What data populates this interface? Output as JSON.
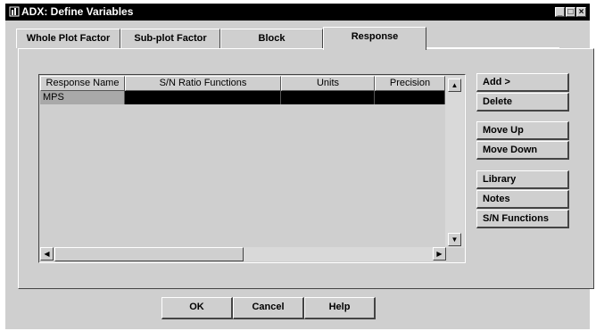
{
  "window": {
    "title": "ADX: Define Variables",
    "controls": {
      "minimize": "_",
      "maximize": "□",
      "close": "×"
    }
  },
  "tabs": [
    {
      "label": "Whole Plot Factor",
      "active": false
    },
    {
      "label": "Sub-plot Factor",
      "active": false
    },
    {
      "label": "Block",
      "active": false
    },
    {
      "label": "Response",
      "active": true
    }
  ],
  "grid": {
    "columns": [
      "Response Name",
      "S/N Ratio Functions",
      "Units",
      "Precision"
    ],
    "rows": [
      {
        "name": "MPS",
        "sn": "",
        "units": "",
        "precision": ""
      }
    ],
    "scroll": {
      "up": "▲",
      "down": "▼",
      "left": "◀",
      "right": "▶"
    }
  },
  "side_buttons": {
    "add": "Add >",
    "delete": "Delete",
    "move_up": "Move Up",
    "move_down": "Move Down",
    "library": "Library",
    "notes": "Notes",
    "sn_functions": "S/N Functions"
  },
  "bottom_buttons": {
    "ok": "OK",
    "cancel": "Cancel",
    "help": "Help"
  },
  "colors": {
    "titlebar": "#000000",
    "face": "#cfcfcf",
    "selected_row": "#000000"
  }
}
